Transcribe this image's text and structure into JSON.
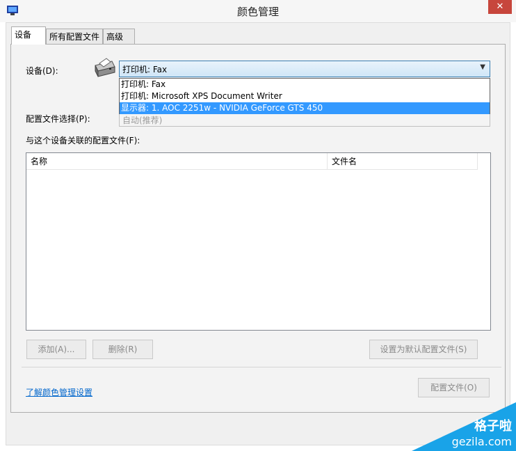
{
  "window": {
    "title": "颜色管理",
    "close_label": "✕"
  },
  "tabs": [
    {
      "label": "设备",
      "active": true
    },
    {
      "label": "所有配置文件",
      "active": false
    },
    {
      "label": "高级",
      "active": false
    }
  ],
  "device": {
    "label": "设备(D):",
    "selected_value": "打印机: Fax",
    "dropdown_options": [
      "打印机: Fax",
      "打印机: Microsoft XPS Document Writer",
      "显示器: 1. AOC 2251w - NVIDIA GeForce GTS 450"
    ],
    "highlighted_index": 2
  },
  "profile_selection": {
    "label": "配置文件选择(P):",
    "value": "自动(推荐)"
  },
  "associated": {
    "label": "与这个设备关联的配置文件(F):",
    "columns": [
      "名称",
      "文件名"
    ],
    "rows": []
  },
  "buttons": {
    "add": "添加(A)...",
    "remove": "删除(R)",
    "set_default": "设置为默认配置文件(S)",
    "profiles": "配置文件(O)"
  },
  "link": "了解颜色管理设置",
  "watermark": {
    "line1": "格子啦",
    "line2": "gezila.com"
  },
  "colors": {
    "accent": "#3399ff",
    "close": "#c7463c",
    "link": "#0066cc",
    "watermark": "#19a3e8"
  }
}
